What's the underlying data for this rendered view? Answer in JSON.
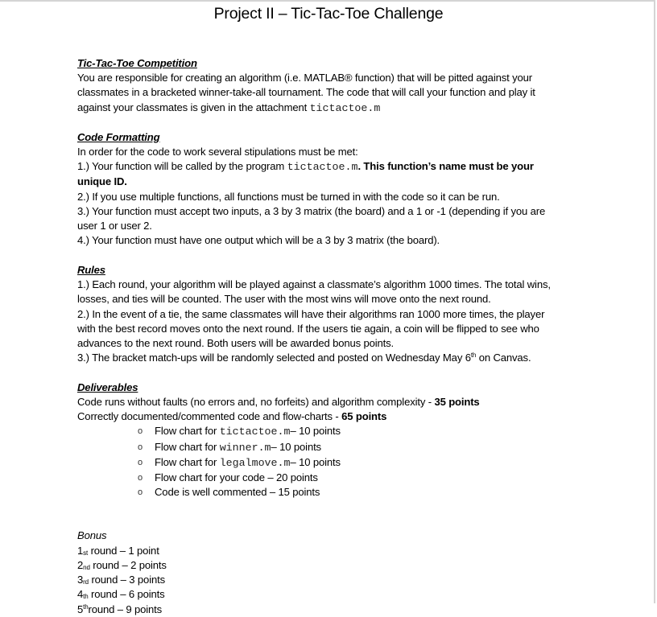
{
  "document": {
    "title": "Project II – Tic-Tac-Toe Challenge",
    "sections": {
      "competition": {
        "heading": "Tic-Tac-Toe Competition",
        "line1": "You are responsible for creating an algorithm (i.e. MATLAB® function) that will be pitted against your",
        "line2": "classmates in a bracketed winner-take-all tournament. The code that will call your function and play it",
        "line3_prefix": "against your classmates is given in the attachment ",
        "line3_code": "tictactoe.m"
      },
      "code_formatting": {
        "heading": "Code Formatting",
        "intro": "In order for the code to work several stipulations must be met:",
        "item1_prefix": "1.) Your function will be called by the program ",
        "item1_code": "tictactoe.m",
        "item1_bold_a": ". This function’s name must be your",
        "item1_bold_b": "unique ID.",
        "item2": "2.) If you use multiple functions, all functions must be turned in with the code so it can be run.",
        "item3_a": "3.) Your function must accept two inputs, a 3 by 3 matrix (the board) and a 1 or -1 (depending if you are",
        "item3_b": "user 1 or user 2.",
        "item4": "4.) Your function must have one output which will be a 3 by 3 matrix (the board)."
      },
      "rules": {
        "heading": "Rules",
        "item1_a": "1.) Each round, your algorithm will be played against a classmate’s algorithm 1000 times. The total wins,",
        "item1_b": "losses, and ties will be counted. The user with the most wins will move onto the next round.",
        "item2_a": "2.) In the event of a tie, the same classmates will have their algorithms ran 1000 more times, the player",
        "item2_b": "with the best record moves onto the next round. If the users tie again, a coin will be flipped to see who",
        "item2_c": "advances to the next round.  Both users will be awarded bonus points.",
        "item3_prefix": "3.) The bracket match-ups will be randomly selected and posted on Wednesday May 6",
        "item3_sup": "th",
        "item3_suffix": " on Canvas."
      },
      "deliverables": {
        "heading": "Deliverables",
        "line1_text": "Code runs without faults (no errors and, no forfeits) and algorithm complexity - ",
        "line1_points": "35 points",
        "line2_text": "Correctly documented/commented code and flow-charts - ",
        "line2_points": "65 points",
        "bullet_glyph": "o",
        "items": [
          {
            "prefix": "Flow chart for ",
            "code": "tictactoe.m",
            "suffix": "– 10 points"
          },
          {
            "prefix": "Flow chart for ",
            "code": "winner.m",
            "suffix": "– 10 points"
          },
          {
            "prefix": "Flow chart for ",
            "code": "legalmove.m",
            "suffix": "– 10 points"
          },
          {
            "prefix": "Flow chart for your code – 20 points",
            "code": "",
            "suffix": ""
          },
          {
            "prefix": "Code is well commented – 15 points",
            "code": "",
            "suffix": ""
          }
        ]
      },
      "bonus": {
        "heading": "Bonus",
        "rounds": [
          {
            "num": "1",
            "ord": "st",
            "text": " round – 1 point"
          },
          {
            "num": "2",
            "ord": "nd",
            "text": " round – 2 points"
          },
          {
            "num": "3",
            "ord": "rd",
            "text": " round – 3 points"
          },
          {
            "num": "4",
            "ord": "th",
            "text": " round – 6 points"
          },
          {
            "num": "5",
            "ord": "th",
            "text": "round –  9 points"
          }
        ]
      }
    }
  }
}
